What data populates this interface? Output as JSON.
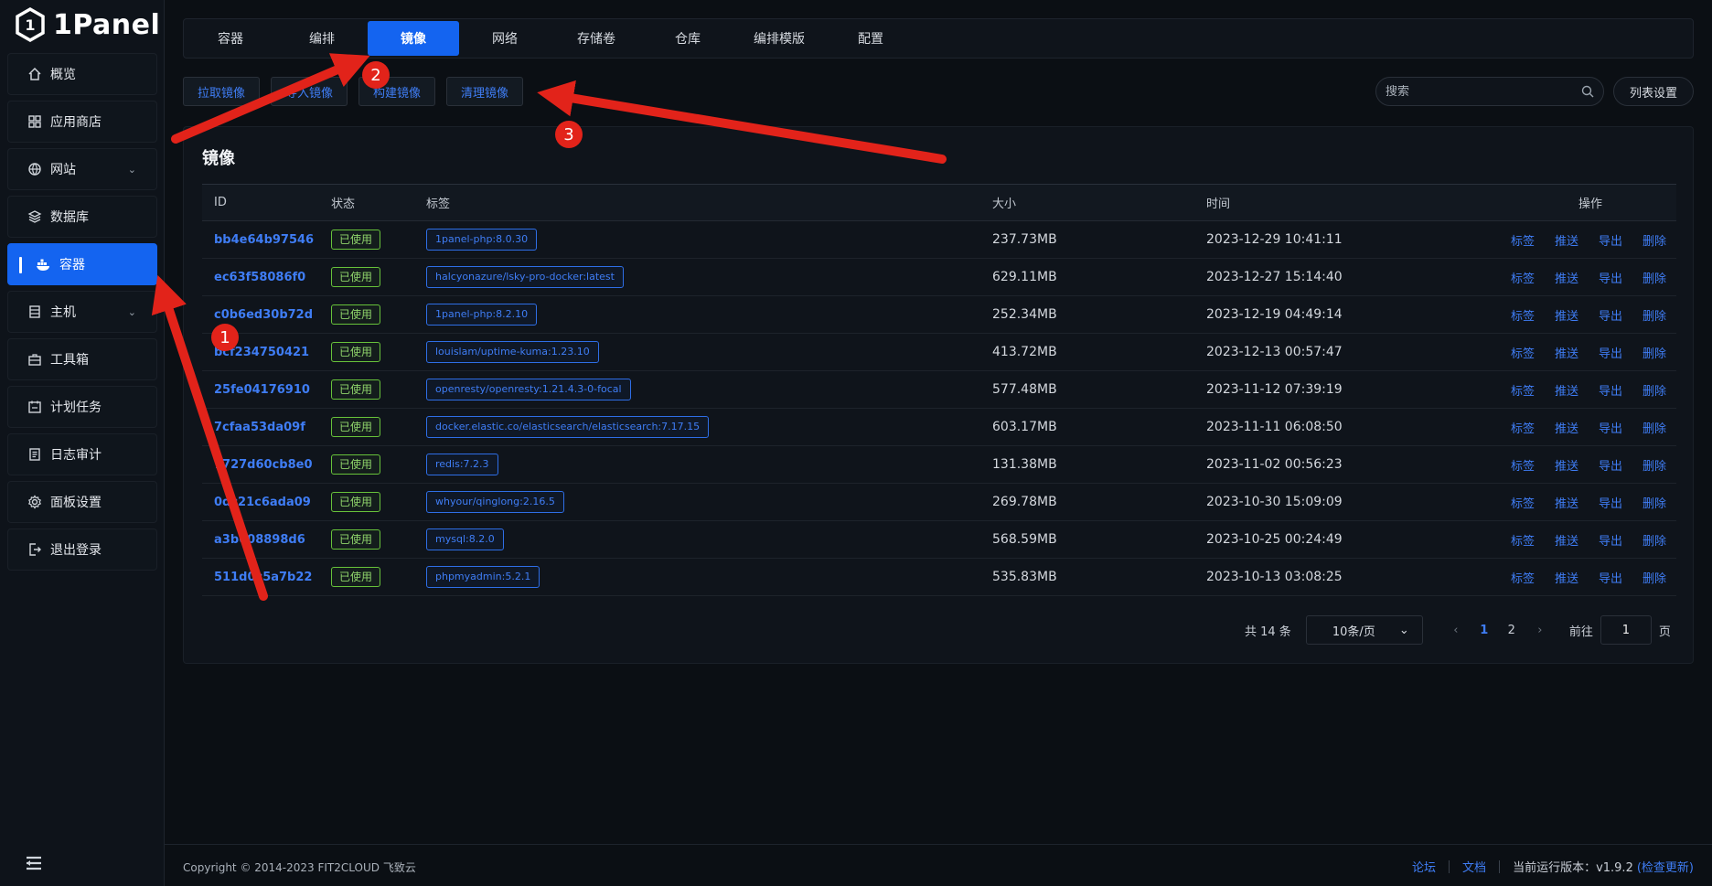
{
  "brand": {
    "logo_text": "1Panel"
  },
  "sidebar": {
    "items": [
      {
        "label": "概览",
        "icon": "home-icon"
      },
      {
        "label": "应用商店",
        "icon": "apps-icon"
      },
      {
        "label": "网站",
        "icon": "globe-icon",
        "has_submenu": true
      },
      {
        "label": "数据库",
        "icon": "layers-icon"
      },
      {
        "label": "容器",
        "icon": "docker-icon",
        "active": true
      },
      {
        "label": "主机",
        "icon": "server-icon",
        "has_submenu": true
      },
      {
        "label": "工具箱",
        "icon": "toolbox-icon"
      },
      {
        "label": "计划任务",
        "icon": "calendar-icon"
      },
      {
        "label": "日志审计",
        "icon": "log-icon"
      },
      {
        "label": "面板设置",
        "icon": "gear-icon"
      },
      {
        "label": "退出登录",
        "icon": "logout-icon"
      }
    ]
  },
  "tabs": [
    "容器",
    "编排",
    "镜像",
    "网络",
    "存储卷",
    "仓库",
    "编排模版",
    "配置"
  ],
  "active_tab": "镜像",
  "toolbar": {
    "buttons": [
      "拉取镜像",
      "导入镜像",
      "构建镜像",
      "清理镜像"
    ],
    "search_placeholder": "搜索",
    "list_settings": "列表设置"
  },
  "card": {
    "title": "镜像",
    "columns": {
      "id": "ID",
      "status": "状态",
      "tags": "标签",
      "size": "大小",
      "time": "时间",
      "ops": "操作"
    },
    "rows": [
      {
        "id": "bb4e64b97546",
        "status": "已使用",
        "tag": "1panel-php:8.0.30",
        "size": "237.73MB",
        "time": "2023-12-29 10:41:11"
      },
      {
        "id": "ec63f58086f0",
        "status": "已使用",
        "tag": "halcyonazure/lsky-pro-docker:latest",
        "size": "629.11MB",
        "time": "2023-12-27 15:14:40"
      },
      {
        "id": "c0b6ed30b72d",
        "status": "已使用",
        "tag": "1panel-php:8.2.10",
        "size": "252.34MB",
        "time": "2023-12-19 04:49:14"
      },
      {
        "id": "bcf234750421",
        "status": "已使用",
        "tag": "louislam/uptime-kuma:1.23.10",
        "size": "413.72MB",
        "time": "2023-12-13 00:57:47"
      },
      {
        "id": "25fe04176910",
        "status": "已使用",
        "tag": "openresty/openresty:1.21.4.3-0-focal",
        "size": "577.48MB",
        "time": "2023-11-12 07:39:19"
      },
      {
        "id": "7cfaa53da09f",
        "status": "已使用",
        "tag": "docker.elastic.co/elasticsearch/elasticsearch:7.17.15",
        "size": "603.17MB",
        "time": "2023-11-11 06:08:50"
      },
      {
        "id": "7727d60cb8e0",
        "status": "已使用",
        "tag": "redis:7.2.3",
        "size": "131.38MB",
        "time": "2023-11-02 00:56:23"
      },
      {
        "id": "0dc21c6ada09",
        "status": "已使用",
        "tag": "whyour/qinglong:2.16.5",
        "size": "269.78MB",
        "time": "2023-10-30 15:09:09"
      },
      {
        "id": "a3b608898d6",
        "status": "已使用",
        "tag": "mysql:8.2.0",
        "size": "568.59MB",
        "time": "2023-10-25 00:24:49"
      },
      {
        "id": "511d0c5a7b22",
        "status": "已使用",
        "tag": "phpmyadmin:5.2.1",
        "size": "535.83MB",
        "time": "2023-10-13 03:08:25"
      }
    ],
    "row_actions": [
      "标签",
      "推送",
      "导出",
      "删除"
    ]
  },
  "pagination": {
    "total": "共 14 条",
    "page_size": "10条/页",
    "pages": [
      "1",
      "2"
    ],
    "current_page": "1",
    "goto_label": "前往",
    "goto_value": "1",
    "goto_suffix": "页"
  },
  "footer": {
    "copyright": "Copyright © 2014-2023 FIT2CLOUD 飞致云",
    "forum": "论坛",
    "docs": "文档",
    "version": "当前运行版本：v1.9.2",
    "check_update": "(检查更新)"
  },
  "annotations": {
    "badges": [
      "1",
      "2",
      "3"
    ],
    "color": "#e2231a"
  },
  "colors": {
    "accent": "#1464f0",
    "link": "#3f7df5",
    "success": "#67c23a",
    "bg": "#0b0f14"
  }
}
